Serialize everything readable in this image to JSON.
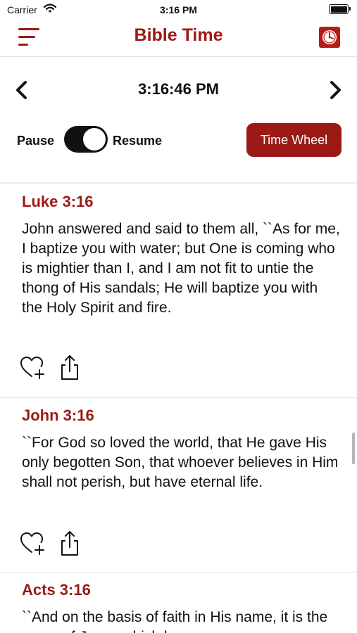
{
  "status_bar": {
    "carrier": "Carrier",
    "time": "3:16 PM"
  },
  "header": {
    "title": "Bible Time"
  },
  "clock": {
    "current_time": "3:16:46 PM"
  },
  "controls": {
    "pause_label": "Pause",
    "resume_label": "Resume",
    "toggle_on": true,
    "time_wheel_label": "Time Wheel"
  },
  "colors": {
    "accent": "#9b1a16",
    "toggle": "#111111"
  },
  "verses": [
    {
      "reference": "Luke 3:16",
      "text": "John answered and said to them all, ``As for me, I baptize you with water; but One is coming who is mightier than I, and I am not fit to untie the thong of His sandals; He will baptize you with the Holy Spirit and fire."
    },
    {
      "reference": "John 3:16",
      "text": "``For God so loved the world, that He gave His only begotten Son, that whoever believes in Him shall not perish, but have eternal life."
    },
    {
      "reference": "Acts 3:16",
      "text": "``And on the basis of faith in His name, it is the name of Jesus which has"
    }
  ],
  "icons": {
    "menu": "menu-icon",
    "clock": "clock-icon",
    "prev": "chevron-left-icon",
    "next": "chevron-right-icon",
    "favorite": "heart-plus-icon",
    "share": "share-icon"
  }
}
